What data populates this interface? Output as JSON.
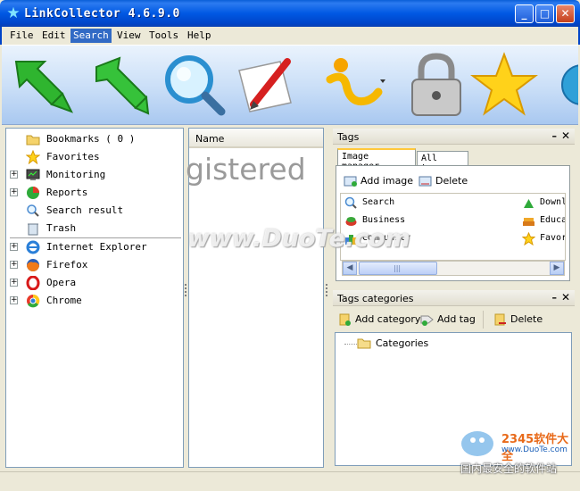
{
  "window": {
    "title": "LinkCollector 4.6.9.0",
    "minimize": "_",
    "maximize": "□",
    "close": "✕"
  },
  "menu": [
    "File",
    "Edit",
    "Search",
    "View",
    "Tools",
    "Help"
  ],
  "toolbar": [
    "arrow-down-icon",
    "arrow-up-icon",
    "magnifier-icon",
    "pencil-paper-icon",
    "info-icon",
    "padlock-icon",
    "star-icon",
    "globe-icon"
  ],
  "left_tree": {
    "group1": [
      {
        "label": "Bookmarks ( 0 )",
        "icon": "folder-icon",
        "expandable": false
      },
      {
        "label": "Favorites",
        "icon": "star-icon",
        "expandable": false
      },
      {
        "label": "Monitoring",
        "icon": "monitor-icon",
        "expandable": true
      },
      {
        "label": "Reports",
        "icon": "pie-chart-icon",
        "expandable": true
      },
      {
        "label": "Search result",
        "icon": "magnifier-icon",
        "expandable": false
      },
      {
        "label": "Trash",
        "icon": "trash-icon",
        "expandable": false
      }
    ],
    "group2": [
      {
        "label": "Internet Explorer",
        "icon": "ie-icon",
        "expandable": true
      },
      {
        "label": "Firefox",
        "icon": "firefox-icon",
        "expandable": true
      },
      {
        "label": "Opera",
        "icon": "opera-icon",
        "expandable": true
      },
      {
        "label": "Chrome",
        "icon": "chrome-icon",
        "expandable": true
      }
    ],
    "expand_glyph": "+"
  },
  "list": {
    "column_header": "Name",
    "overlay_text": "gistered"
  },
  "tags_panel": {
    "title": "Tags",
    "pin": "–",
    "close": "✕",
    "tabs": [
      "Image manager",
      "All tags"
    ],
    "add_image": "Add image",
    "delete": "Delete",
    "items": [
      {
        "label": "Search",
        "icon": "magnifier-icon"
      },
      {
        "label": "Business",
        "icon": "business-icon"
      },
      {
        "label": "Community",
        "icon": "community-icon"
      },
      {
        "label": "Downl",
        "icon": "download-icon"
      },
      {
        "label": "Educa",
        "icon": "books-icon"
      },
      {
        "label": "Favor",
        "icon": "star-icon"
      }
    ],
    "scroll_left": "◀",
    "scroll_right": "▶",
    "scroll_grip": "|||"
  },
  "tag_categories_panel": {
    "title": "Tags categories",
    "pin": "–",
    "close": "✕",
    "add_category": "Add category",
    "add_tag": "Add tag",
    "delete": "Delete",
    "root": "Categories"
  },
  "watermarks": {
    "duote": "www.DuoTe.com",
    "logo_brand": "2345软件大全",
    "logo_url": "www.DuoTe.com",
    "logo_caption": "国内最安全的软件站"
  },
  "colors": {
    "titlebar": "#0058e3",
    "menu_active": "#316ac5",
    "tab_accent": "#ffc83c",
    "panel_border": "#7f9db9"
  }
}
